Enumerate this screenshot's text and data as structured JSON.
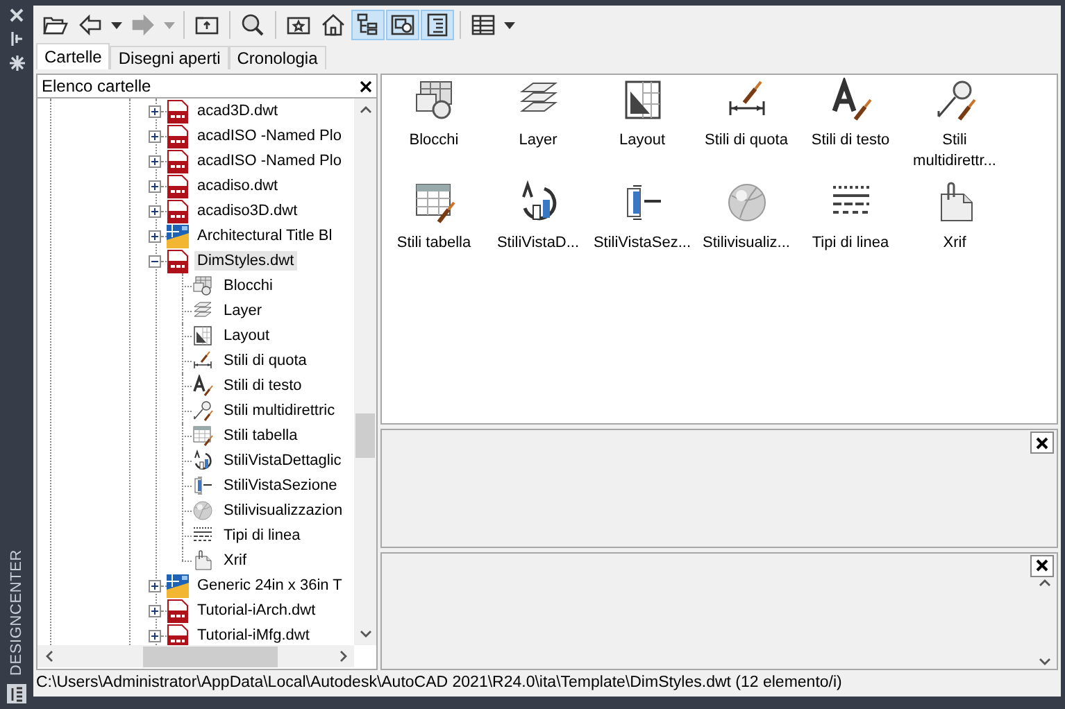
{
  "sidebar": {
    "title": "DESIGNCENTER"
  },
  "toolbar": {
    "buttons": [
      {
        "kind": "open",
        "selected": false,
        "disabled": false
      },
      {
        "kind": "back",
        "selected": false,
        "disabled": false
      },
      {
        "kind": "menu",
        "selected": false,
        "disabled": false
      },
      {
        "kind": "forward",
        "selected": false,
        "disabled": true
      },
      {
        "kind": "menu",
        "selected": false,
        "disabled": true
      },
      {
        "kind": "up",
        "selected": false,
        "disabled": false
      },
      {
        "kind": "search",
        "selected": false,
        "disabled": false
      },
      {
        "kind": "favorites",
        "selected": false,
        "disabled": false
      },
      {
        "kind": "home",
        "selected": false,
        "disabled": false
      },
      {
        "kind": "tree",
        "selected": true,
        "disabled": false
      },
      {
        "kind": "preview",
        "selected": true,
        "disabled": false
      },
      {
        "kind": "description",
        "selected": true,
        "disabled": false
      },
      {
        "kind": "views",
        "selected": false,
        "disabled": false
      },
      {
        "kind": "menu",
        "selected": false,
        "disabled": false
      }
    ]
  },
  "tabs": [
    {
      "label": "Cartelle",
      "selected": true
    },
    {
      "label": "Disegni aperti",
      "selected": false
    },
    {
      "label": "Cronologia",
      "selected": false
    }
  ],
  "tree": {
    "title": "Elenco cartelle",
    "items": [
      {
        "label": "acad3D.dwt",
        "kind": "template",
        "expanded": false,
        "selected": false
      },
      {
        "label": "acadISO -Named Plo",
        "kind": "template",
        "expanded": false,
        "selected": false
      },
      {
        "label": "acadISO -Named Plo",
        "kind": "template",
        "expanded": false,
        "selected": false
      },
      {
        "label": "acadiso.dwt",
        "kind": "template",
        "expanded": false,
        "selected": false
      },
      {
        "label": "acadiso3D.dwt",
        "kind": "template",
        "expanded": false,
        "selected": false
      },
      {
        "label": "Architectural Title Bl",
        "kind": "sheet-set",
        "expanded": false,
        "selected": false
      },
      {
        "label": "DimStyles.dwt",
        "kind": "template",
        "expanded": true,
        "selected": true,
        "children": [
          {
            "label": "Blocchi"
          },
          {
            "label": "Layer"
          },
          {
            "label": "Layout"
          },
          {
            "label": "Stili di quota"
          },
          {
            "label": "Stili di testo"
          },
          {
            "label": "Stili multidirettric"
          },
          {
            "label": "Stili tabella"
          },
          {
            "label": "StiliVistaDettaglic"
          },
          {
            "label": "StiliVistaSezione"
          },
          {
            "label": "Stilivisualizzazion"
          },
          {
            "label": "Tipi di linea"
          },
          {
            "label": "Xrif"
          }
        ]
      },
      {
        "label": "Generic 24in x 36in T",
        "kind": "sheet-set",
        "expanded": false,
        "selected": false
      },
      {
        "label": "Tutorial-iArch.dwt",
        "kind": "template",
        "expanded": false,
        "selected": false
      },
      {
        "label": "Tutorial-iMfg.dwt",
        "kind": "template",
        "expanded": false,
        "selected": false
      }
    ]
  },
  "content": {
    "items": [
      {
        "label": "Blocchi"
      },
      {
        "label": "Layer"
      },
      {
        "label": "Layout"
      },
      {
        "label": "Stili di quota"
      },
      {
        "label": "Stili di testo"
      },
      {
        "label": "Stili multidirettr..."
      },
      {
        "label": "Stili tabella"
      },
      {
        "label": "StiliVistaD..."
      },
      {
        "label": "StiliVistaSez..."
      },
      {
        "label": "Stilivisualiz..."
      },
      {
        "label": "Tipi di linea"
      },
      {
        "label": "Xrif"
      }
    ]
  },
  "status_bar": "C:\\Users\\Administrator\\AppData\\Local\\Autodesk\\AutoCAD 2021\\R24.0\\ita\\Template\\DimStyles.dwt (12 elemento/i)"
}
